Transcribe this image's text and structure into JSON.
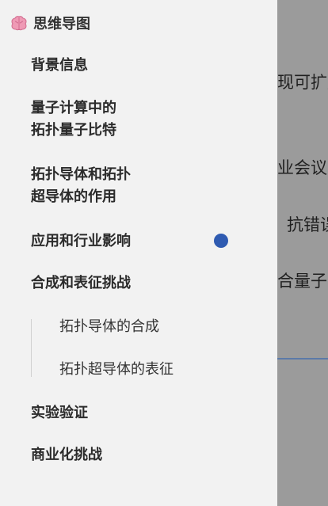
{
  "drawer": {
    "title": "思维导图",
    "items": [
      {
        "label": "背景信息"
      },
      {
        "label_lines": [
          "量子计算中的",
          "拓扑量子比特"
        ]
      },
      {
        "label_lines": [
          "拓扑导体和拓扑",
          "超导体的作用"
        ]
      },
      {
        "label": "应用和行业影响",
        "active": true
      },
      {
        "label": "合成和表征挑战"
      },
      {
        "label": "实验验证"
      },
      {
        "label": "商业化挑战"
      }
    ],
    "subitems": [
      {
        "label": "拓扑导体的合成"
      },
      {
        "label": "拓扑超导体的表征"
      }
    ]
  },
  "background": {
    "fragments": [
      {
        "text": "现可扩户"
      },
      {
        "text": "业会议, "
      },
      {
        "text": "抗错误"
      },
      {
        "text": "合量子扌"
      }
    ]
  },
  "colors": {
    "drawer_bg": "#f2f2f2",
    "overlay_bg": "#9b9b9b",
    "active_dot": "#2f5bb1"
  },
  "icons": {
    "header_icon": "brain-icon"
  }
}
